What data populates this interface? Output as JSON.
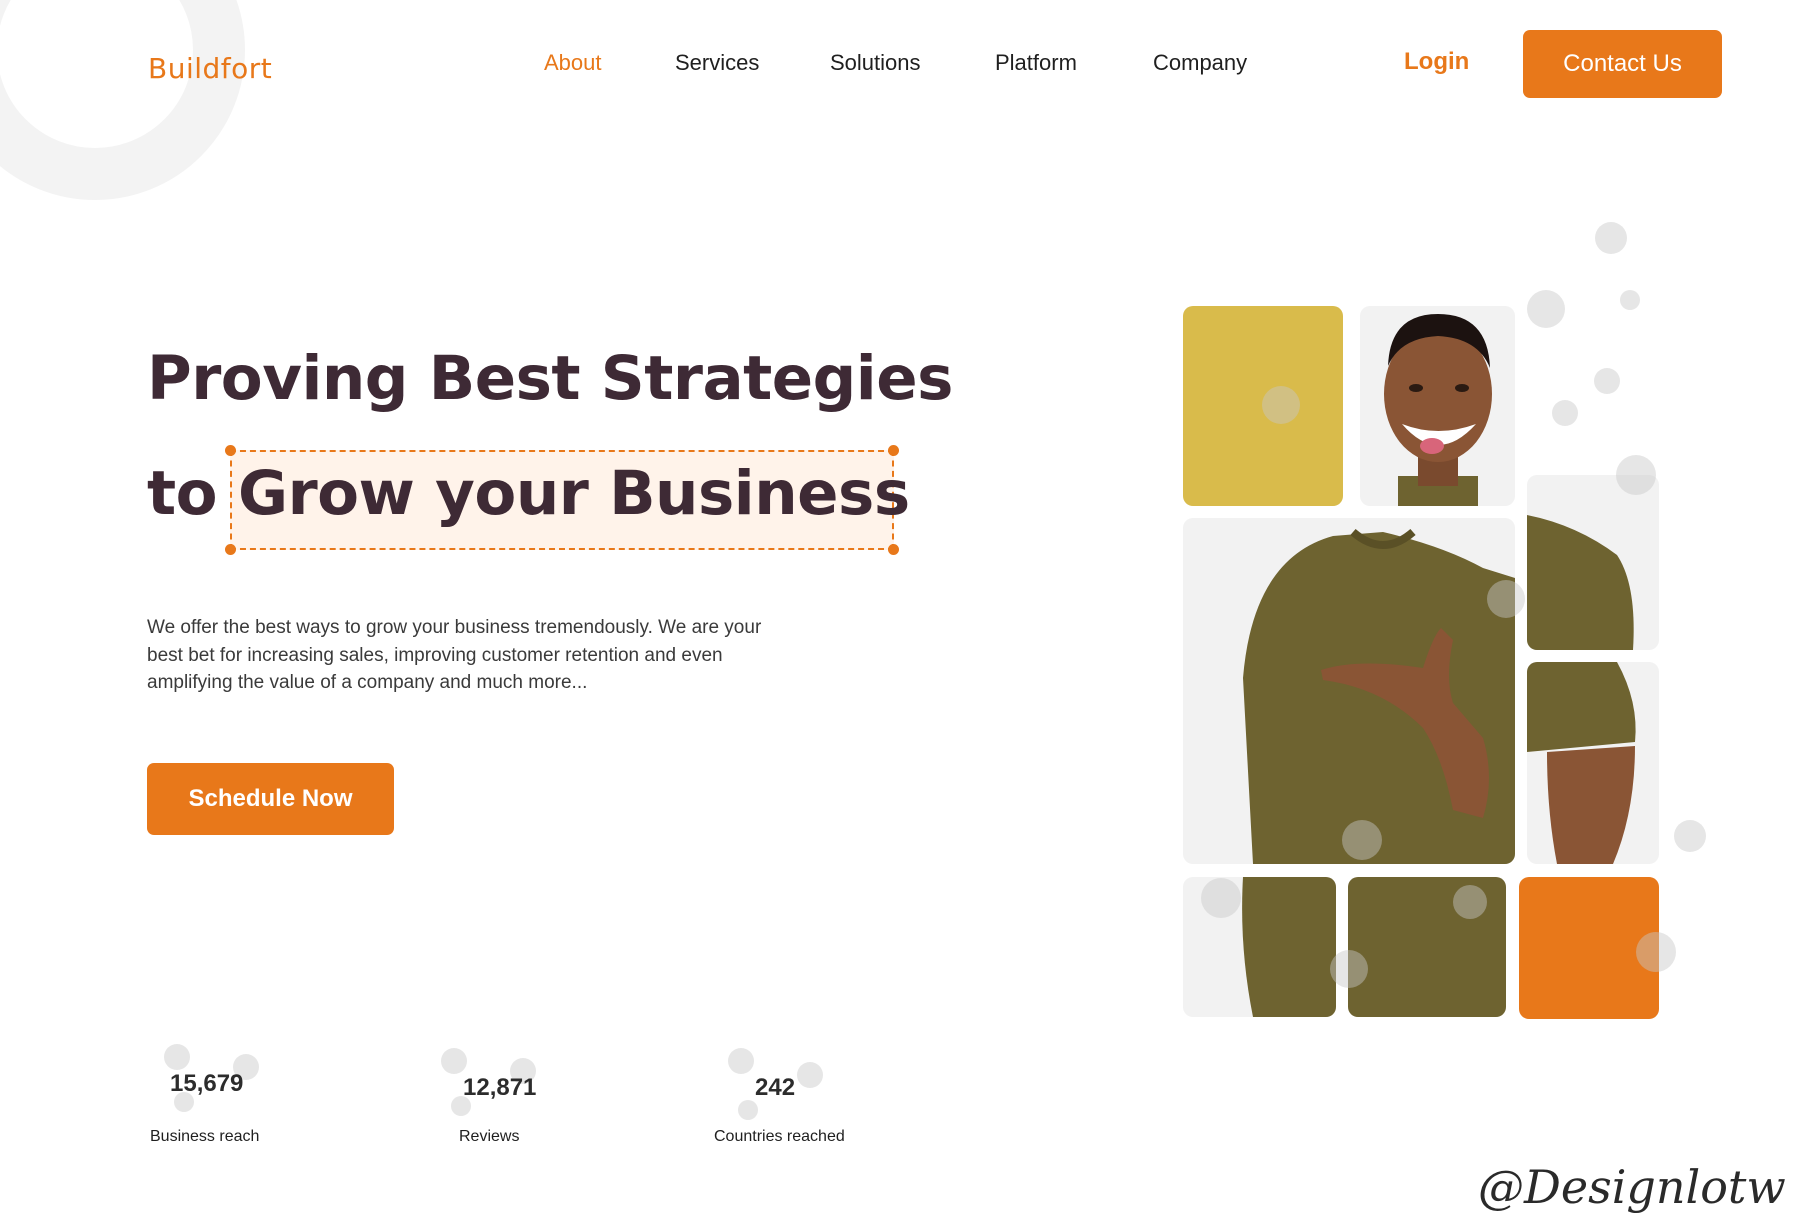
{
  "brand": {
    "logo_text": "Buildfort",
    "accent_color": "#e8781a",
    "heading_color": "#3e2a35"
  },
  "nav": {
    "items": [
      {
        "label": "About",
        "active": true
      },
      {
        "label": "Services",
        "active": false
      },
      {
        "label": "Solutions",
        "active": false
      },
      {
        "label": "Platform",
        "active": false
      },
      {
        "label": "Company",
        "active": false
      }
    ],
    "login_label": "Login",
    "contact_label": "Contact Us"
  },
  "hero": {
    "headline_line1": "Proving Best Strategies",
    "headline_line2_prefix": "to",
    "headline_line2_highlight": "Grow your Business",
    "description": "We offer the best ways to grow your business tremendously. We are your best bet for increasing sales, improving customer retention and even amplifying the value of a company and much more...",
    "cta_label": "Schedule Now"
  },
  "stats": [
    {
      "value": "15,679",
      "label": "Business reach"
    },
    {
      "value": "12,871",
      "label": "Reviews"
    },
    {
      "value": "242",
      "label": "Countries reached"
    }
  ],
  "collage": {
    "tile_colors": {
      "yellow": "#d9bb4b",
      "orange": "#e8781a",
      "grey": "#f2f2f2"
    },
    "person_shirt_color": "#6e6330"
  },
  "watermark": "@Designlotw"
}
